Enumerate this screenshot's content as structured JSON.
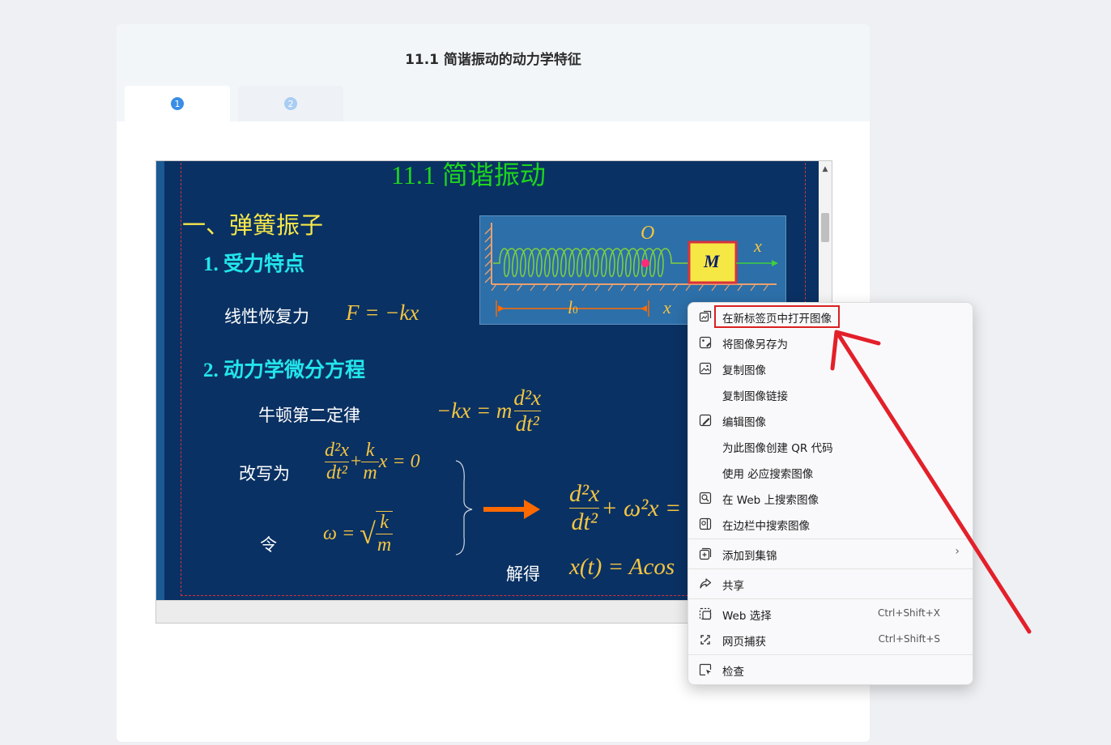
{
  "page": {
    "title": "11.1 简谐振动的动力学特征"
  },
  "tabs": [
    {
      "label": "1"
    },
    {
      "label": "2"
    }
  ],
  "slide": {
    "heading": "11.1   简谐振动",
    "section_title": "一、弹簧振子",
    "sub1": "1. 受力特点",
    "restoring_force_label": "线性恢复力",
    "restoring_force_eq": "F = −kx",
    "sub2": "2. 动力学微分方程",
    "newton_label": "牛顿第二定律",
    "rewrite_label": "改写为",
    "let_label": "令",
    "solution_label": "解得",
    "diagram": {
      "origin_label": "O",
      "mass_label": "M",
      "axis_label": "x",
      "l0_label": "l",
      "l0_sub": "0",
      "x_label": "x"
    },
    "eq_newton": {
      "lhs": "−kx = m",
      "num": "d²x",
      "den": "dt²"
    },
    "eq_rewrite": {
      "num": "d²x",
      "den": "dt²",
      "plus": "+",
      "k": "k",
      "m": "m",
      "tail": "x = 0"
    },
    "eq_omega": {
      "lhs": "ω =",
      "k": "k",
      "m": "m"
    },
    "eq_result": {
      "num": "d²x",
      "den": "dt²",
      "tail": "+ ω²x ="
    },
    "eq_solution": "x(t) = Acos"
  },
  "context_menu": {
    "items": [
      {
        "label": "在新标签页中打开图像",
        "icon": "open-in-new-tab-icon"
      },
      {
        "label": "将图像另存为",
        "icon": "save-image-icon"
      },
      {
        "label": "复制图像",
        "icon": "copy-image-icon"
      },
      {
        "label": "复制图像链接",
        "icon": ""
      },
      {
        "label": "编辑图像",
        "icon": "edit-image-icon"
      },
      {
        "label": "为此图像创建 QR 代码",
        "icon": ""
      },
      {
        "label": "使用 必应搜索图像",
        "icon": ""
      },
      {
        "label": "在 Web 上搜索图像",
        "icon": "visual-search-icon"
      },
      {
        "label": "在边栏中搜索图像",
        "icon": "sidebar-search-icon"
      },
      {
        "label": "添加到集锦",
        "icon": "collections-icon"
      },
      {
        "label": "共享",
        "icon": "share-icon"
      },
      {
        "label": "Web 选择",
        "icon": "web-select-icon",
        "shortcut": "Ctrl+Shift+X"
      },
      {
        "label": "网页捕获",
        "icon": "web-capture-icon",
        "shortcut": "Ctrl+Shift+S"
      },
      {
        "label": "检查",
        "icon": "inspect-icon"
      }
    ]
  },
  "colors": {
    "highlight": "#d92020",
    "slide_bg": "#0a3163",
    "slide_title": "#1ed41e",
    "slide_heading": "#f6e84a",
    "slide_sub": "#22e6ec",
    "math": "#f4c542"
  }
}
